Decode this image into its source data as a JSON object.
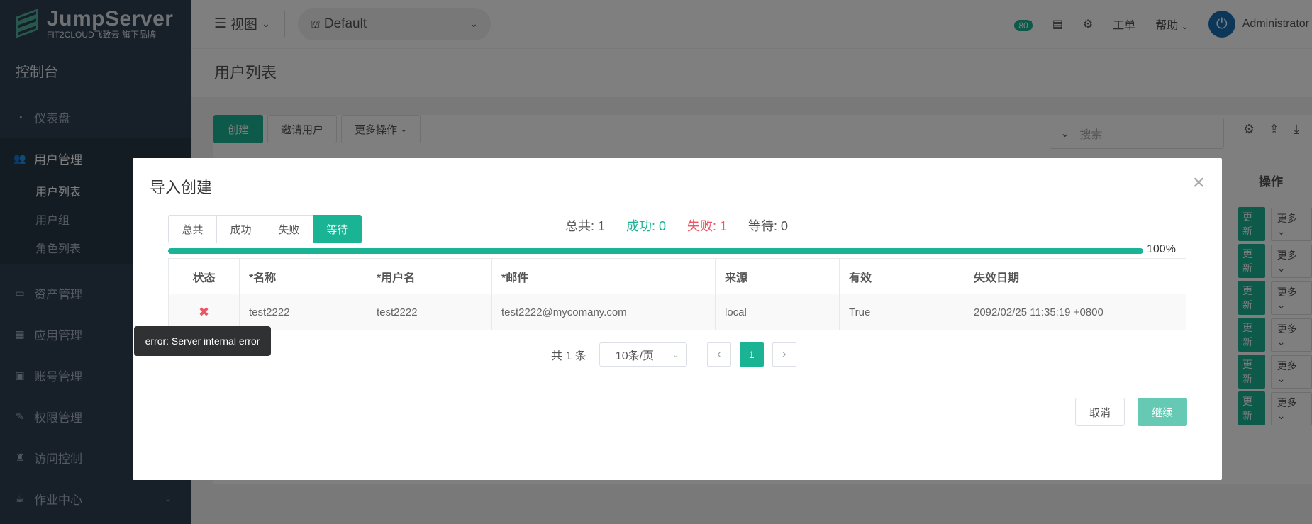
{
  "brand": {
    "name": "JumpServer",
    "sub": "FIT2CLOUD飞致云 旗下品牌"
  },
  "sidebar": {
    "console": "控制台",
    "items": [
      {
        "label": "仪表盘"
      },
      {
        "label": "用户管理",
        "children": [
          "用户列表",
          "用户组",
          "角色列表"
        ]
      },
      {
        "label": "资产管理"
      },
      {
        "label": "应用管理"
      },
      {
        "label": "账号管理"
      },
      {
        "label": "权限管理"
      },
      {
        "label": "访问控制"
      },
      {
        "label": "作业中心"
      }
    ]
  },
  "topbar": {
    "view": "视图",
    "org": "Default",
    "badge": "80",
    "ticket": "工单",
    "help": "帮助",
    "user": "Administrator"
  },
  "page": {
    "title": "用户列表"
  },
  "toolbar": {
    "create": "创建",
    "invite": "邀请用户",
    "more": "更多操作",
    "search_placeholder": "搜索"
  },
  "table_bg": {
    "op": "操作",
    "refresh": "更新",
    "more": "更多"
  },
  "modal": {
    "title": "导入创建",
    "tabs": [
      "总共",
      "成功",
      "失败",
      "等待"
    ],
    "summary": {
      "total": "总共: 1",
      "success": "成功: 0",
      "failed": "失败: 1",
      "pending": "等待: 0"
    },
    "progress_percent": 100,
    "progress_label": "100%",
    "columns": [
      "状态",
      "*名称",
      "*用户名",
      "*邮件",
      "来源",
      "有效",
      "失效日期"
    ],
    "rows": [
      {
        "name": "test2222",
        "username": "test2222",
        "email": "test2222@mycomany.com",
        "source": "local",
        "valid": "True",
        "expire": "2092/02/25 11:35:19 +0800"
      }
    ],
    "pager": {
      "total": "共 1 条",
      "size": "10条/页",
      "page": "1"
    },
    "cancel": "取消",
    "continue": "继续"
  },
  "tooltip": "error: Server internal error",
  "colors": {
    "accent": "#1ab394",
    "danger": "#ed5565",
    "sidebar": "#2f4050"
  }
}
